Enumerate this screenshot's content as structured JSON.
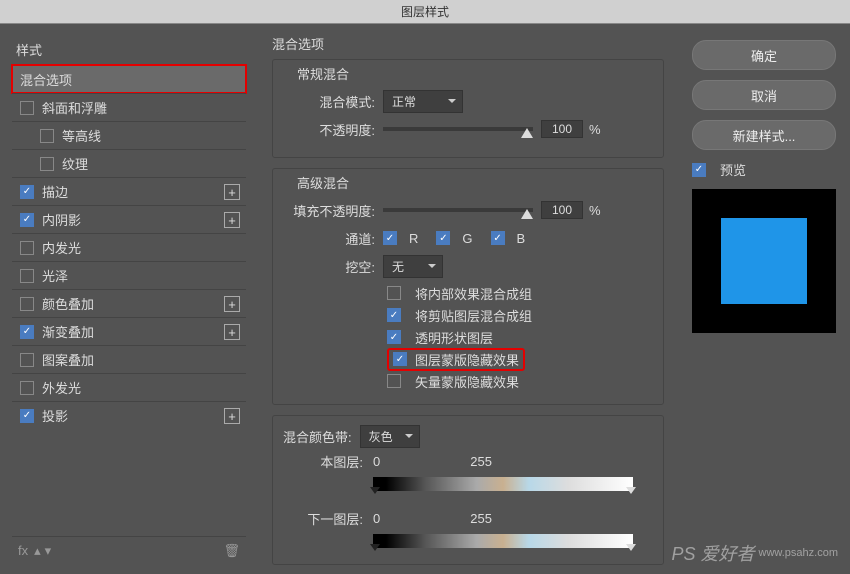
{
  "title": "图层样式",
  "sidebar": {
    "header": "样式",
    "items": [
      {
        "label": "混合选项",
        "checked": null,
        "selected": true,
        "highlight": true,
        "plus": false,
        "indent": false
      },
      {
        "label": "斜面和浮雕",
        "checked": false,
        "plus": false,
        "indent": false
      },
      {
        "label": "等高线",
        "checked": false,
        "plus": false,
        "indent": true
      },
      {
        "label": "纹理",
        "checked": false,
        "plus": false,
        "indent": true
      },
      {
        "label": "描边",
        "checked": true,
        "plus": true,
        "indent": false
      },
      {
        "label": "内阴影",
        "checked": true,
        "plus": true,
        "indent": false
      },
      {
        "label": "内发光",
        "checked": false,
        "plus": false,
        "indent": false
      },
      {
        "label": "光泽",
        "checked": false,
        "plus": false,
        "indent": false
      },
      {
        "label": "颜色叠加",
        "checked": false,
        "plus": true,
        "indent": false
      },
      {
        "label": "渐变叠加",
        "checked": true,
        "plus": true,
        "indent": false
      },
      {
        "label": "图案叠加",
        "checked": false,
        "plus": false,
        "indent": false
      },
      {
        "label": "外发光",
        "checked": false,
        "plus": false,
        "indent": false
      },
      {
        "label": "投影",
        "checked": true,
        "plus": true,
        "indent": false
      }
    ],
    "footer_fx": "fx"
  },
  "center": {
    "title": "混合选项",
    "normal": {
      "title": "常规混合",
      "mode_label": "混合模式:",
      "mode_value": "正常",
      "opacity_label": "不透明度:",
      "opacity_value": "100",
      "pct": "%"
    },
    "advanced": {
      "title": "高级混合",
      "fill_label": "填充不透明度:",
      "fill_value": "100",
      "pct": "%",
      "channel_label": "通道:",
      "ch_r": "R",
      "ch_g": "G",
      "ch_b": "B",
      "knockout_label": "挖空:",
      "knockout_value": "无",
      "opts": [
        {
          "label": "将内部效果混合成组",
          "checked": false
        },
        {
          "label": "将剪贴图层混合成组",
          "checked": true
        },
        {
          "label": "透明形状图层",
          "checked": true
        },
        {
          "label": "图层蒙版隐藏效果",
          "checked": true,
          "highlight": true
        },
        {
          "label": "矢量蒙版隐藏效果",
          "checked": false
        }
      ]
    },
    "blendif": {
      "title": "混合颜色带:",
      "value": "灰色",
      "this_label": "本图层:",
      "this_lo": "0",
      "this_hi": "255",
      "under_label": "下一图层:",
      "under_lo": "0",
      "under_hi": "255"
    }
  },
  "right": {
    "ok": "确定",
    "cancel": "取消",
    "newstyle": "新建样式...",
    "preview": "预览"
  },
  "watermark": {
    "brand": "PS 爱好者",
    "url": "www.psahz.com"
  }
}
